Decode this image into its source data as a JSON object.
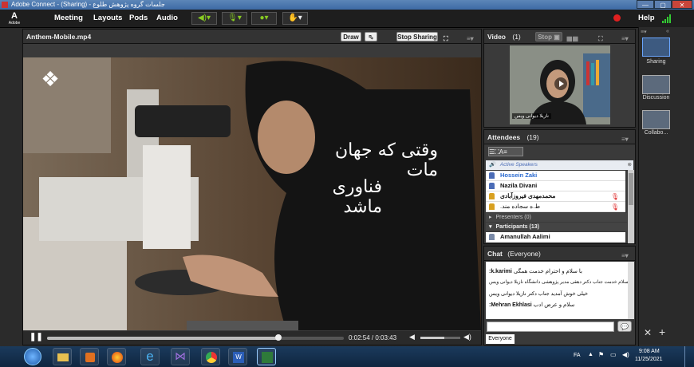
{
  "window": {
    "title": "جلسات گروه پژوهش طلوع - (Sharing) - Adobe Connect",
    "minimize": "—",
    "maximize": "▢",
    "close": "✕"
  },
  "menubar": {
    "logo": "A",
    "logo_sub": "Adobe",
    "items": [
      "Meeting",
      "Layouts",
      "Pods",
      "Audio"
    ],
    "help": "Help"
  },
  "share_pod": {
    "title": "Anthem-Mobile.mp4",
    "draw_button": "Draw",
    "stop_sharing_button": "Stop Sharing",
    "caption_line1": "وقتی که جهان مات",
    "caption_line2": "فناوری ماشد",
    "time": "0:02:54 / 0:03:43",
    "progress": 0.78,
    "volume": 0.6
  },
  "video_pod": {
    "title": "Video",
    "count": "(1)",
    "stop_button": "Stop",
    "speaker_name": "نازیلا دیوانی ویس"
  },
  "attendees_pod": {
    "title": "Attendees",
    "count": "(19)",
    "active_speakers_label": "Active Speakers",
    "rows": [
      {
        "name": "Hossein Zaki",
        "highlight": true
      },
      {
        "name": "Nazila Divani",
        "highlight": false
      },
      {
        "name": "محمدمهدی فیروزآبادی",
        "highlight": false
      },
      {
        "name": "ط.ه سجاده مند.",
        "highlight": false
      }
    ],
    "presenters_label": "Presenters (0)",
    "participants_label": "Participants (13)",
    "participants": [
      "Amanullah Aalimi"
    ]
  },
  "chat_pod": {
    "title": "Chat",
    "scope": "(Everyone)",
    "messages": [
      {
        "sender": "k.karimi:",
        "text": "با سلام و احترام خدمت همگی"
      },
      {
        "sender": "",
        "text": "سلام خدمت جناب دکتر دهقی مدیر پژوهشی دانشگاه نازیلا دیوانی ویس"
      },
      {
        "sender": "",
        "text": "خیلی خوش آمدید جناب دکتر نازیلا دیوانی ویس"
      },
      {
        "sender": "Mehran Ekhlasi:",
        "text": "سلام و عرض ادب"
      }
    ],
    "tab": "Everyone"
  },
  "side_panel": {
    "items": [
      "Sharing",
      "Discussion",
      "Collabo..."
    ]
  },
  "taskbar": {
    "lang": "FA",
    "time": "9:08 AM",
    "date": "11/25/2021"
  }
}
